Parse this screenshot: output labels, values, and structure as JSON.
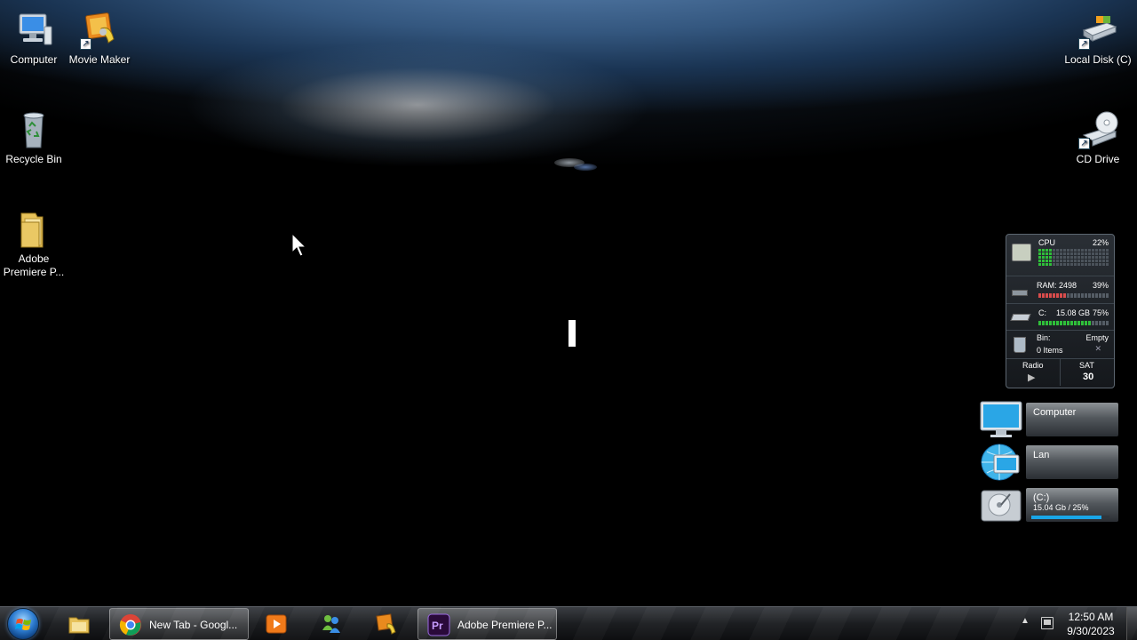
{
  "desktop": {
    "icons_left": [
      {
        "label": "Computer"
      },
      {
        "label": "Movie Maker"
      },
      {
        "label": "Recycle Bin"
      },
      {
        "label": "Adobe Premiere P..."
      }
    ],
    "icons_right": [
      {
        "label": "Local Disk (C)"
      },
      {
        "label": "CD Drive"
      }
    ]
  },
  "system_gadget": {
    "cpu": {
      "label": "CPU",
      "percent": "22%",
      "level": 0.22
    },
    "ram": {
      "label": "RAM: 2498",
      "percent": "39%",
      "level": 0.39
    },
    "disk": {
      "label": "C:",
      "size": "15.08 GB",
      "percent": "75%",
      "level": 0.75
    },
    "bin": {
      "label": "Bin:",
      "status": "Empty",
      "items": "0 Items"
    },
    "radio": {
      "label": "Radio"
    },
    "date": {
      "day": "SAT",
      "number": "30"
    }
  },
  "widgets": {
    "computer": {
      "label": "Computer"
    },
    "lan": {
      "label": "Lan"
    },
    "drive": {
      "label": "(C:)",
      "detail": "15.04 Gb / 25%",
      "level": 0.25
    }
  },
  "taskbar": {
    "buttons": [
      {
        "label": "New Tab - Googl...",
        "icon": "chrome-icon"
      },
      {
        "label": "Adobe Premiere P...",
        "icon": "premiere-icon"
      }
    ],
    "pinned": [
      "explorer-icon",
      "media-player-icon",
      "messenger-icon",
      "movie-maker-icon"
    ],
    "clock": {
      "time": "12:50 AM",
      "date": "9/30/2023"
    }
  },
  "colors": {
    "accent_blue": "#2c7bd0",
    "meter_green": "#2fbf3a",
    "meter_red": "#d94c4c",
    "drive_bar": "#19a6e8"
  }
}
